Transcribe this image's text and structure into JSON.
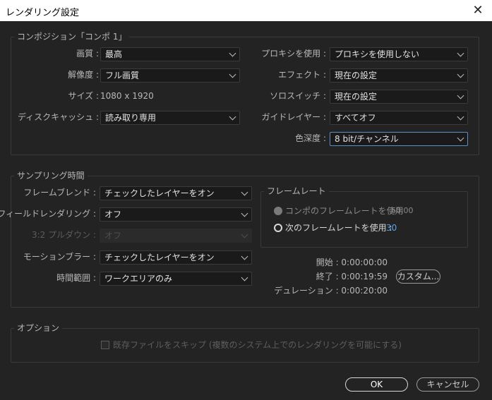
{
  "window": {
    "title": "レンダリング設定",
    "close_glyph": "✕"
  },
  "composition": {
    "title": "コンポジション「コンポ 1」",
    "quality_label": "画質 :",
    "quality_value": "最高",
    "resolution_label": "解像度 :",
    "resolution_value": "フル画質",
    "size_label": "サイズ :",
    "size_value": "1080 x 1920",
    "disk_cache_label": "ディスクキャッシュ :",
    "disk_cache_value": "読み取り専用",
    "proxy_label": "プロキシを使用 :",
    "proxy_value": "プロキシを使用しない",
    "effects_label": "エフェクト :",
    "effects_value": "現在の設定",
    "solo_label": "ソロスイッチ :",
    "solo_value": "現在の設定",
    "guide_label": "ガイドレイヤー :",
    "guide_value": "すべてオフ",
    "color_depth_label": "色深度 :",
    "color_depth_value": "8 bit/チャンネル"
  },
  "sampling": {
    "title": "サンプリング時間",
    "frame_blend_label": "フレームブレンド :",
    "frame_blend_value": "チェックしたレイヤーをオン",
    "field_render_label": "フィールドレンダリング :",
    "field_render_value": "オフ",
    "pulldown_label": "3:2 プルダウン :",
    "pulldown_value": "オフ",
    "motion_blur_label": "モーションブラー :",
    "motion_blur_value": "チェックしたレイヤーをオン",
    "time_span_label": "時間範囲 :",
    "time_span_value": "ワークエリアのみ",
    "frame_rate": {
      "title": "フレームレート",
      "option1_label": "コンポのフレームレートを使用",
      "option1_value": "60.00",
      "option2_label": "次のフレームレートを使用 :",
      "option2_value": "30",
      "selected": "option2"
    },
    "start_text": "開始 : 0:00:00:00",
    "end_text": "終了 : 0:00:19:59",
    "custom_button": "カスタム...",
    "duration_text": "デュレーション : 0:00:20:00"
  },
  "options": {
    "title": "オプション",
    "skip_existing_label": "既存ファイルをスキップ (複数のシステム上でのレンダリングを可能にする)",
    "skip_existing_checked": false
  },
  "buttons": {
    "ok": "OK",
    "cancel": "キャンセル"
  },
  "colors": {
    "background": "#232323",
    "accent_blue": "#5ba2e0",
    "focus_border": "#5a90c8"
  }
}
